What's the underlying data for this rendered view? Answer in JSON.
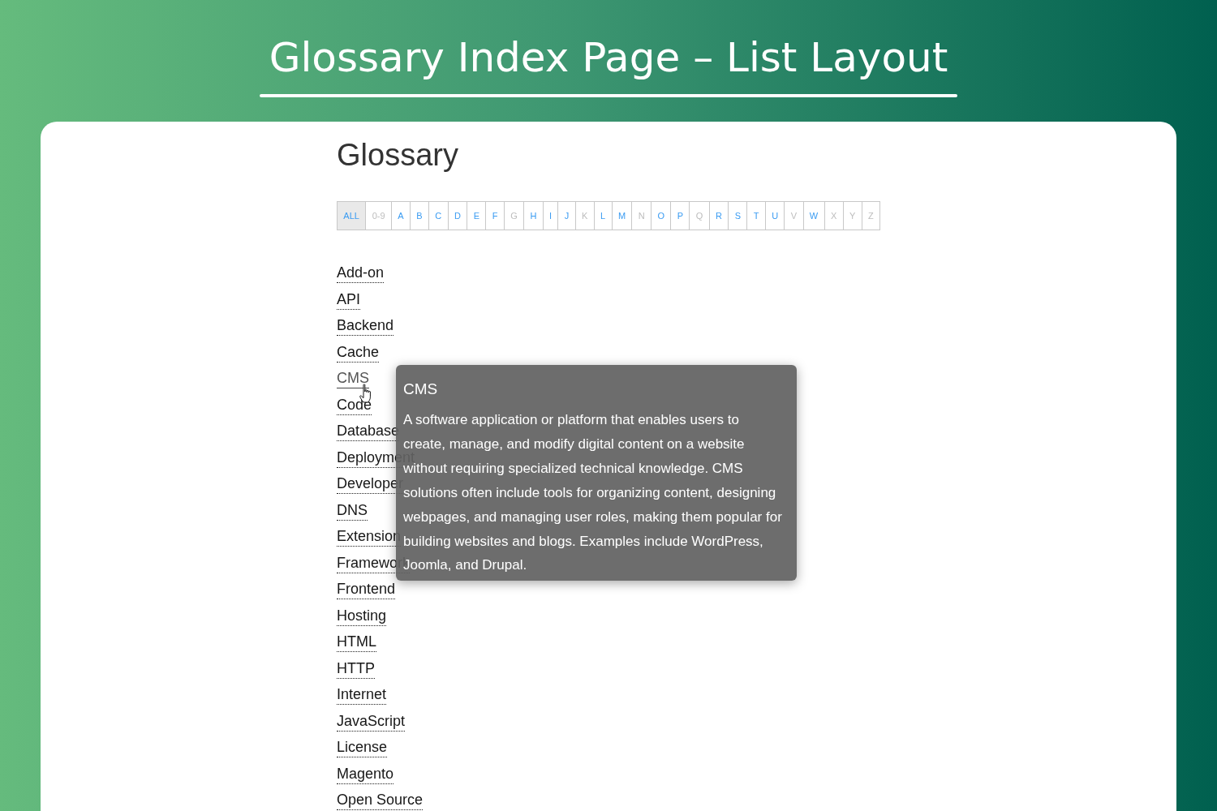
{
  "banner": {
    "title": "Glossary Index Page – List Layout"
  },
  "heading": "Glossary",
  "letters": [
    {
      "label": "ALL",
      "selected": true,
      "available": true
    },
    {
      "label": "0-9",
      "selected": false,
      "available": false
    },
    {
      "label": "A",
      "selected": false,
      "available": true
    },
    {
      "label": "B",
      "selected": false,
      "available": true
    },
    {
      "label": "C",
      "selected": false,
      "available": true
    },
    {
      "label": "D",
      "selected": false,
      "available": true
    },
    {
      "label": "E",
      "selected": false,
      "available": true
    },
    {
      "label": "F",
      "selected": false,
      "available": true
    },
    {
      "label": "G",
      "selected": false,
      "available": false
    },
    {
      "label": "H",
      "selected": false,
      "available": true
    },
    {
      "label": "I",
      "selected": false,
      "available": true
    },
    {
      "label": "J",
      "selected": false,
      "available": true
    },
    {
      "label": "K",
      "selected": false,
      "available": false
    },
    {
      "label": "L",
      "selected": false,
      "available": true
    },
    {
      "label": "M",
      "selected": false,
      "available": true
    },
    {
      "label": "N",
      "selected": false,
      "available": false
    },
    {
      "label": "O",
      "selected": false,
      "available": true
    },
    {
      "label": "P",
      "selected": false,
      "available": true
    },
    {
      "label": "Q",
      "selected": false,
      "available": false
    },
    {
      "label": "R",
      "selected": false,
      "available": true
    },
    {
      "label": "S",
      "selected": false,
      "available": true
    },
    {
      "label": "T",
      "selected": false,
      "available": true
    },
    {
      "label": "U",
      "selected": false,
      "available": true
    },
    {
      "label": "V",
      "selected": false,
      "available": false
    },
    {
      "label": "W",
      "selected": false,
      "available": true
    },
    {
      "label": "X",
      "selected": false,
      "available": false
    },
    {
      "label": "Y",
      "selected": false,
      "available": false
    },
    {
      "label": "Z",
      "selected": false,
      "available": false
    }
  ],
  "terms": [
    {
      "label": "Add-on",
      "hovered": false
    },
    {
      "label": "API",
      "hovered": false
    },
    {
      "label": "Backend",
      "hovered": false
    },
    {
      "label": "Cache",
      "hovered": false
    },
    {
      "label": "CMS",
      "hovered": true
    },
    {
      "label": "Code",
      "hovered": false
    },
    {
      "label": "Database",
      "hovered": false
    },
    {
      "label": "Deployment",
      "hovered": false
    },
    {
      "label": "Developer",
      "hovered": false
    },
    {
      "label": "DNS",
      "hovered": false
    },
    {
      "label": "Extension",
      "hovered": false
    },
    {
      "label": "Framework",
      "hovered": false
    },
    {
      "label": "Frontend",
      "hovered": false
    },
    {
      "label": "Hosting",
      "hovered": false
    },
    {
      "label": "HTML",
      "hovered": false
    },
    {
      "label": "HTTP",
      "hovered": false
    },
    {
      "label": "Internet",
      "hovered": false
    },
    {
      "label": "JavaScript",
      "hovered": false
    },
    {
      "label": "License",
      "hovered": false
    },
    {
      "label": "Magento",
      "hovered": false
    },
    {
      "label": "Open Source",
      "hovered": false
    }
  ],
  "tooltip": {
    "title": "CMS",
    "text": "A software application or platform that enables users to create, manage, and modify digital content on a website without requiring specialized technical knowledge. CMS solutions often include tools for organizing content, designing webpages, and managing user roles, making them popular for building websites and blogs. Examples include WordPress, Joomla, and Drupal."
  }
}
